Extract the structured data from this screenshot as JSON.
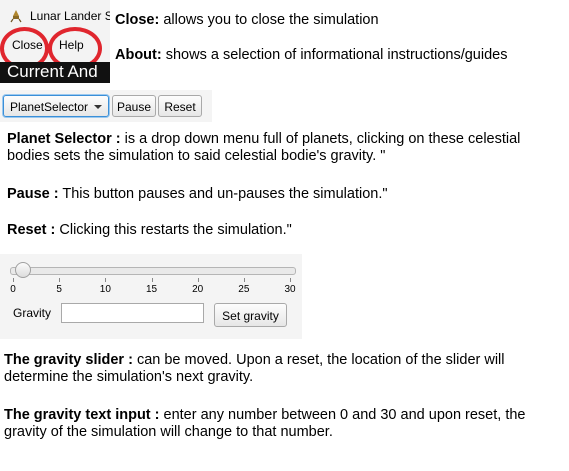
{
  "window": {
    "title": "Lunar Lander S"
  },
  "menu": {
    "close": "Close",
    "help": "Help"
  },
  "dark_strip": {
    "text": "Current And"
  },
  "toolbar": {
    "planet_selector": "PlanetSelector",
    "pause": "Pause",
    "reset": "Reset"
  },
  "slider": {
    "ticks": [
      "0",
      "5",
      "10",
      "15",
      "20",
      "25",
      "30"
    ],
    "value": 1
  },
  "gravity": {
    "label": "Gravity",
    "input_value": "",
    "set_button": "Set gravity"
  },
  "desc": {
    "close_term": "Close:",
    "close_text": " allows you to close the simulation",
    "about_term": "About:",
    "about_text": " shows a selection of informational instructions/guides",
    "planet_term": "Planet Selector :",
    "planet_text": " is a drop down menu full of planets, clicking on these celestial bodies sets the simulation to said celestial bodie's gravity. \"",
    "pause_term": "Pause :",
    "pause_text": " This button pauses and un-pauses the simulation.\"",
    "reset_term": "Reset :",
    "reset_text": " Clicking this restarts the simulation.\"",
    "slider_term": "The gravity slider :",
    "slider_text": " can be moved. Upon a reset, the location of the slider will determine the simulation's next gravity.",
    "input_term": "The gravity text input :",
    "input_text": " enter any number between 0 and 30 and upon reset, the gravity of the simulation will change to that number."
  },
  "colors": {
    "highlight_circle": "#e0262e",
    "focus_border": "#3a8fd8"
  }
}
